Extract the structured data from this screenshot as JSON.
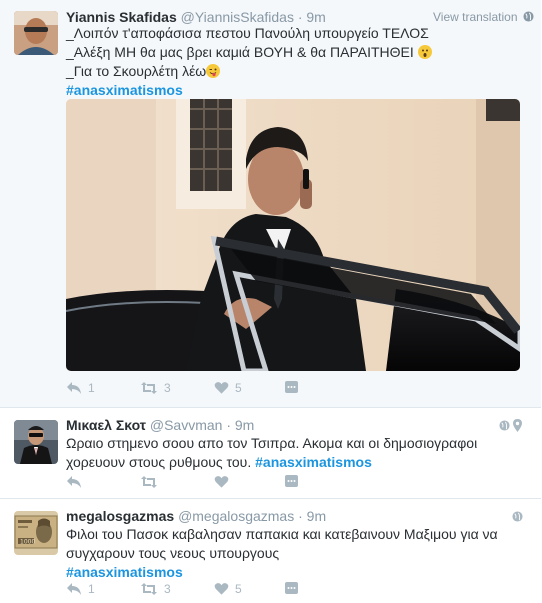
{
  "tweets": [
    {
      "name": "Yiannis Skafidas",
      "handle": "@YiannisSkafidas",
      "time": "· 9m",
      "view_translation": "View translation",
      "lines": [
        "_Λοιπόν τ'αποφάσισα πεστου Πανούλη υπουργείο ΤΕΛΟΣ",
        "_Αλέξη ΜΗ θα μας βρει καμιά ΒΟΥΗ & θα ΠΑΡΑΙΤΗΘΕΙ",
        "_Για το Σκουρλέτη λέω"
      ],
      "hashtag": "#anasximatismos",
      "retweets": "3",
      "likes": "5",
      "replies": "1"
    },
    {
      "name": "Μικαελ Σκοτ",
      "handle": "@Savvman",
      "time": "· 9m",
      "text": "Ωραιο στημενο σοου απο τον Τσιπρα. Ακομα και οι δημοσιογραφοι χορευουν στους ρυθμους του.",
      "hashtag": "#anasximatismos"
    },
    {
      "name": "megalosgazmas",
      "handle": "@megalosgazmas",
      "time": "· 9m",
      "text": "Φιλοι του Πασοκ καβαλησαν παπακια και κατεβαινουν Μαξιμου για να συγχαρουν τους νεους υπουργους",
      "hashtag": "#anasximatismos",
      "retweets": "3",
      "likes": "5",
      "replies": "1"
    }
  ],
  "colors": {
    "accent": "#1b95e0",
    "muted": "#8899a6",
    "icon": "#aab8c2",
    "border": "#e1e8ed",
    "highlight_bg": "#f5f8fa"
  },
  "icons": [
    "globe-icon",
    "location-icon",
    "reply-icon",
    "retweet-icon",
    "heart-icon",
    "more-icon"
  ]
}
